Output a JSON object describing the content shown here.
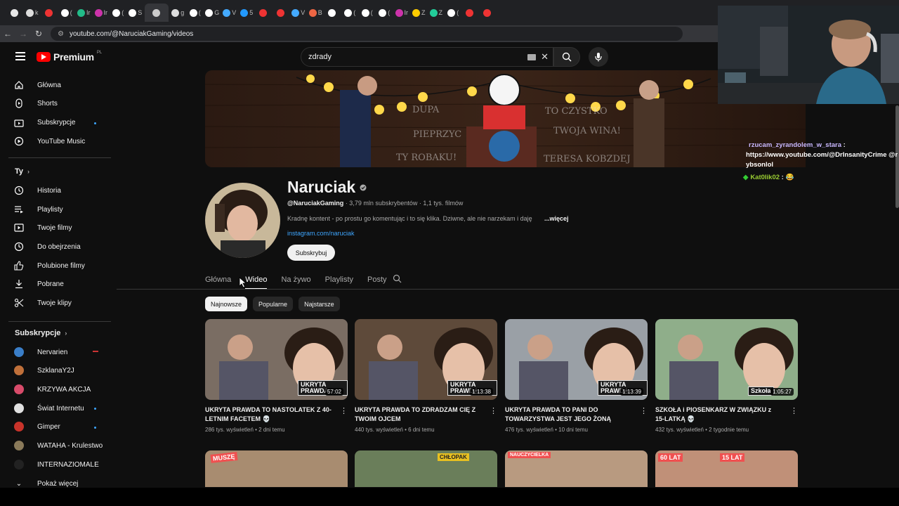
{
  "browser": {
    "tab_labels": [
      "",
      "k",
      "",
      "(",
      "Ir",
      "Ir",
      "(",
      "S",
      "",
      "g",
      "(",
      "G",
      "V",
      "5",
      "",
      "",
      "V",
      "B",
      "",
      "(",
      "(",
      "(",
      "Ir",
      "Z",
      "Z",
      "(",
      "",
      ""
    ],
    "url": "youtube.com/@NaruciakGaming/videos"
  },
  "header": {
    "logo_text": "Premium",
    "logo_region": "PL",
    "search_value": "zdrady"
  },
  "sidebar": {
    "main_items": [
      {
        "label": "Główna",
        "icon": "home-icon"
      },
      {
        "label": "Shorts",
        "icon": "shorts-icon"
      },
      {
        "label": "Subskrypcje",
        "icon": "subscriptions-icon"
      },
      {
        "label": "YouTube Music",
        "icon": "music-icon"
      }
    ],
    "you_header": "Ty",
    "you_items": [
      {
        "label": "Historia",
        "icon": "history-icon"
      },
      {
        "label": "Playlisty",
        "icon": "playlist-icon"
      },
      {
        "label": "Twoje filmy",
        "icon": "your-videos-icon"
      },
      {
        "label": "Do obejrzenia",
        "icon": "clock-icon"
      },
      {
        "label": "Polubione filmy",
        "icon": "thumb-up-icon"
      },
      {
        "label": "Pobrane",
        "icon": "download-icon"
      },
      {
        "label": "Twoje klipy",
        "icon": "scissors-icon"
      }
    ],
    "subs_header": "Subskrypcje",
    "subscriptions": [
      {
        "label": "Nervarien",
        "color": "#3a7ec8"
      },
      {
        "label": "SzklanaY2J",
        "color": "#c0703a"
      },
      {
        "label": "KRZYWA AKCJA",
        "color": "#d84b6a"
      },
      {
        "label": "Świat Internetu",
        "color": "#e0e0e0"
      },
      {
        "label": "Gimper",
        "color": "#c8332a"
      },
      {
        "label": "WATAHA - Krulestwo",
        "color": "#8a7a5a"
      },
      {
        "label": "INTERNAZIOMALE",
        "color": "#222222"
      }
    ],
    "show_more": "Pokaż więcej"
  },
  "channel": {
    "name": "Naruciak",
    "handle": "@NaruciakGaming",
    "stats": " · 3,79 mln subskrybentów · 1,1 tys. filmów",
    "description": "Kradnę kontent - po prostu go komentując i to się klika. Dziwne, ale nie narzekam i daję",
    "more": "...więcej",
    "link": "instagram.com/naruciak",
    "subscribe_label": "Subskrybuj"
  },
  "tabs": [
    "Główna",
    "Wideo",
    "Na żywo",
    "Playlisty",
    "Posty"
  ],
  "chips": [
    "Najnowsze",
    "Popularne",
    "Najstarsze"
  ],
  "videos": [
    {
      "title": "UKRYTA PRAWDA TO NASTOLATEK Z 40-LETNIM FACETEM 💀",
      "meta": "286 tys. wyświetleń • 2 dni temu",
      "duration": "57:02",
      "badge": "UKRYTA PRAWDA",
      "bg": "#7a6d63"
    },
    {
      "title": "UKRYTA PRAWDA TO ZDRADZAM CIĘ Z TWOIM OJCEM",
      "meta": "440 tys. wyświetleń • 6 dni temu",
      "duration": "1:13:38",
      "badge": "UKRYTA PRAWDA",
      "bg": "#5e4a3a"
    },
    {
      "title": "UKRYTA PRAWDA TO PANI DO TOWARZYSTWA JEST JEGO ŻONĄ",
      "meta": "476 tys. wyświetleń • 10 dni temu",
      "duration": "1:13:39",
      "badge": "UKRYTA PRAWDA",
      "bg": "#9aa0a6"
    },
    {
      "title": "SZKOŁA i PIOSENKARZ W ZWIĄZKU z 15-LATKĄ 💀",
      "meta": "432 tys. wyświetleń • 2 tygodnie temu",
      "duration": "1:05:27",
      "badge": "Szkoła",
      "bg": "#8fae8a"
    }
  ],
  "chat": [
    {
      "user": "rzucam_zyrandolem_w_stara",
      "text": "https://www.youtube.com/@DrInsanityCrime @rybsonlol",
      "user_color": "#c9b8ff"
    },
    {
      "user": "Kat0lik02",
      "text": "😂",
      "user_color": "#9acd32"
    }
  ]
}
